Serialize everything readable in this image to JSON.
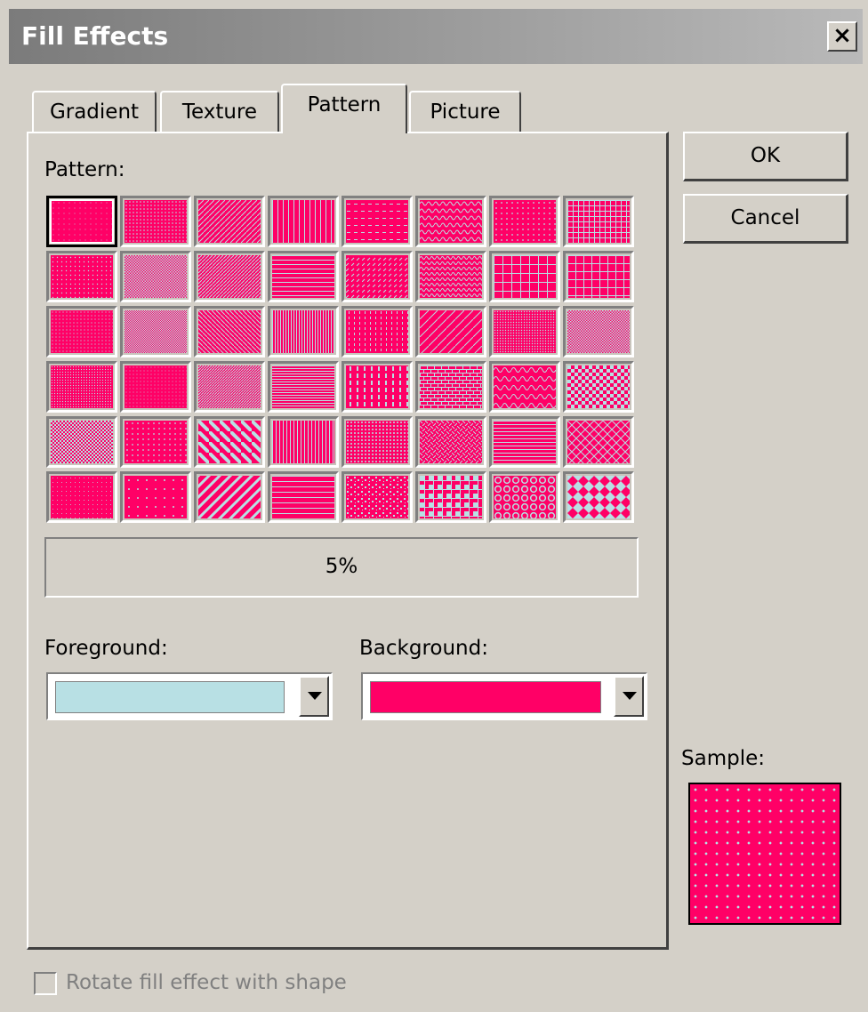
{
  "window": {
    "title": "Fill Effects"
  },
  "tabs": [
    {
      "label": "Gradient",
      "active": false
    },
    {
      "label": "Texture",
      "active": false
    },
    {
      "label": "Pattern",
      "active": true
    },
    {
      "label": "Picture",
      "active": false
    }
  ],
  "pattern": {
    "label": "Pattern:",
    "selected_name": "5%",
    "selected_index": 0,
    "foreground_color": "#ff0066",
    "background_color": "#b8e0e4",
    "rows": 6,
    "columns": 8
  },
  "foreground": {
    "label": "Foreground:",
    "color": "#b8e0e4"
  },
  "background": {
    "label": "Background:",
    "color": "#ff0066"
  },
  "buttons": {
    "ok": "OK",
    "cancel": "Cancel"
  },
  "sample": {
    "label": "Sample:"
  },
  "rotate": {
    "label": "Rotate fill effect with shape",
    "checked": false,
    "enabled": false
  },
  "icons": {
    "close": "close-icon",
    "dropdown": "chevron-down-icon"
  }
}
